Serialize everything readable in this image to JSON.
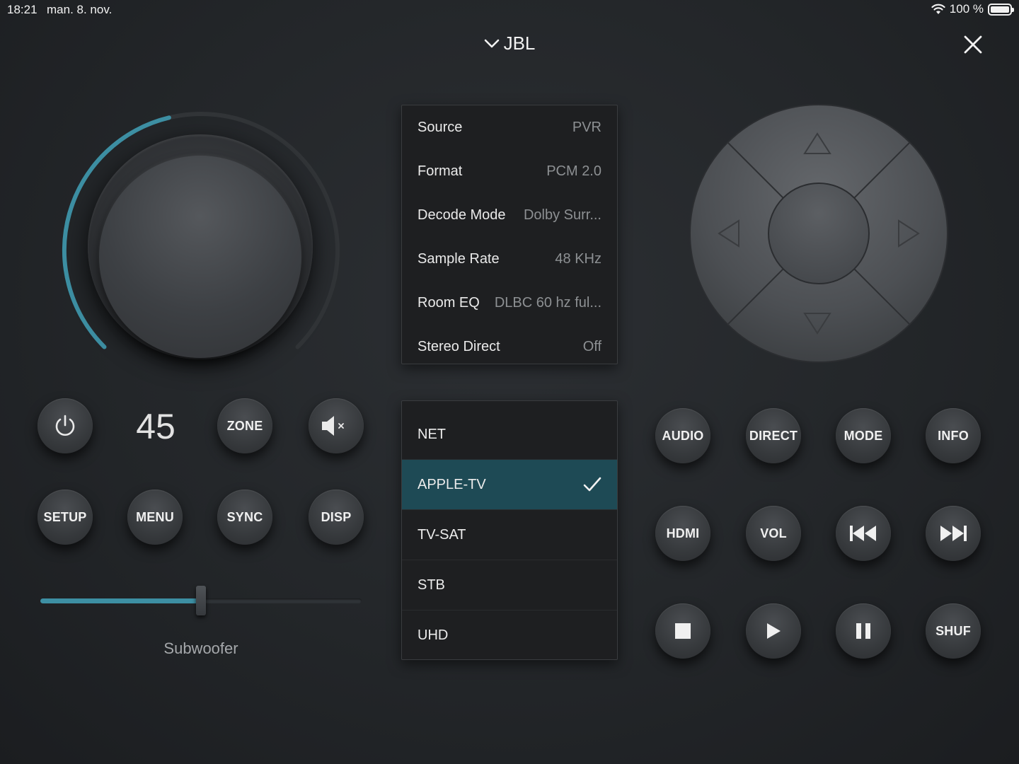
{
  "status": {
    "time": "18:21",
    "date": "man. 8. nov.",
    "battery": "100 %"
  },
  "header": {
    "title": "JBL"
  },
  "volume": {
    "value": "45",
    "level_fraction": 0.45
  },
  "buttons_left": {
    "zone": "ZONE",
    "setup": "SETUP",
    "menu": "MENU",
    "sync": "SYNC",
    "disp": "DISP"
  },
  "subwoofer": {
    "label": "Subwoofer",
    "level_fraction": 0.5
  },
  "info": [
    {
      "label": "Source",
      "value": "PVR"
    },
    {
      "label": "Format",
      "value": "PCM 2.0"
    },
    {
      "label": "Decode Mode",
      "value": "Dolby Surr..."
    },
    {
      "label": "Sample Rate",
      "value": "48 KHz"
    },
    {
      "label": "Room EQ",
      "value": "DLBC 60 hz ful..."
    },
    {
      "label": "Stereo Direct",
      "value": "Off"
    }
  ],
  "sources": [
    {
      "label": "NET",
      "selected": false
    },
    {
      "label": "APPLE-TV",
      "selected": true
    },
    {
      "label": "TV-SAT",
      "selected": false
    },
    {
      "label": "STB",
      "selected": false
    },
    {
      "label": "UHD",
      "selected": false
    }
  ],
  "buttons_right": {
    "audio": "AUDIO",
    "direct": "DIRECT",
    "mode": "MODE",
    "info": "INFO",
    "hdmi": "HDMI",
    "vol": "VOL",
    "shuf": "SHUF"
  },
  "colors": {
    "accent": "#3d8fa3",
    "selected_bg": "#1e4a55",
    "background": "#232629"
  },
  "icons": [
    "wifi-icon",
    "battery-icon",
    "chevron-down-icon",
    "close-icon",
    "power-icon",
    "mute-icon",
    "previous-icon",
    "next-icon",
    "stop-icon",
    "play-icon",
    "pause-icon",
    "checkmark-icon",
    "arrow-up-icon",
    "arrow-down-icon",
    "arrow-left-icon",
    "arrow-right-icon"
  ]
}
